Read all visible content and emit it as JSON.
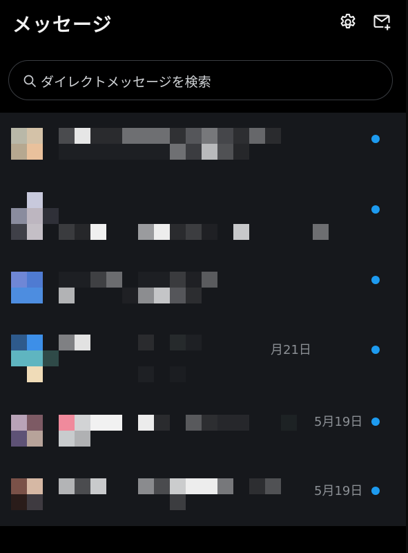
{
  "header": {
    "title": "メッセージ",
    "settings_icon": "gear-icon",
    "compose_icon": "new-message-icon"
  },
  "search": {
    "icon": "search-icon",
    "placeholder": "ダイレクトメッセージを検索"
  },
  "conversations": [
    {
      "date": "",
      "unread": true
    },
    {
      "date": "",
      "unread": true
    },
    {
      "date": "",
      "unread": true
    },
    {
      "date": "月21日",
      "unread": true
    },
    {
      "date": "5月19日",
      "unread": true
    },
    {
      "date": "5月19日",
      "unread": true
    }
  ],
  "colors": {
    "background": "#000000",
    "list_background": "#16181c",
    "unread_dot": "#1d9bf0",
    "date_text": "#8b8f94"
  }
}
